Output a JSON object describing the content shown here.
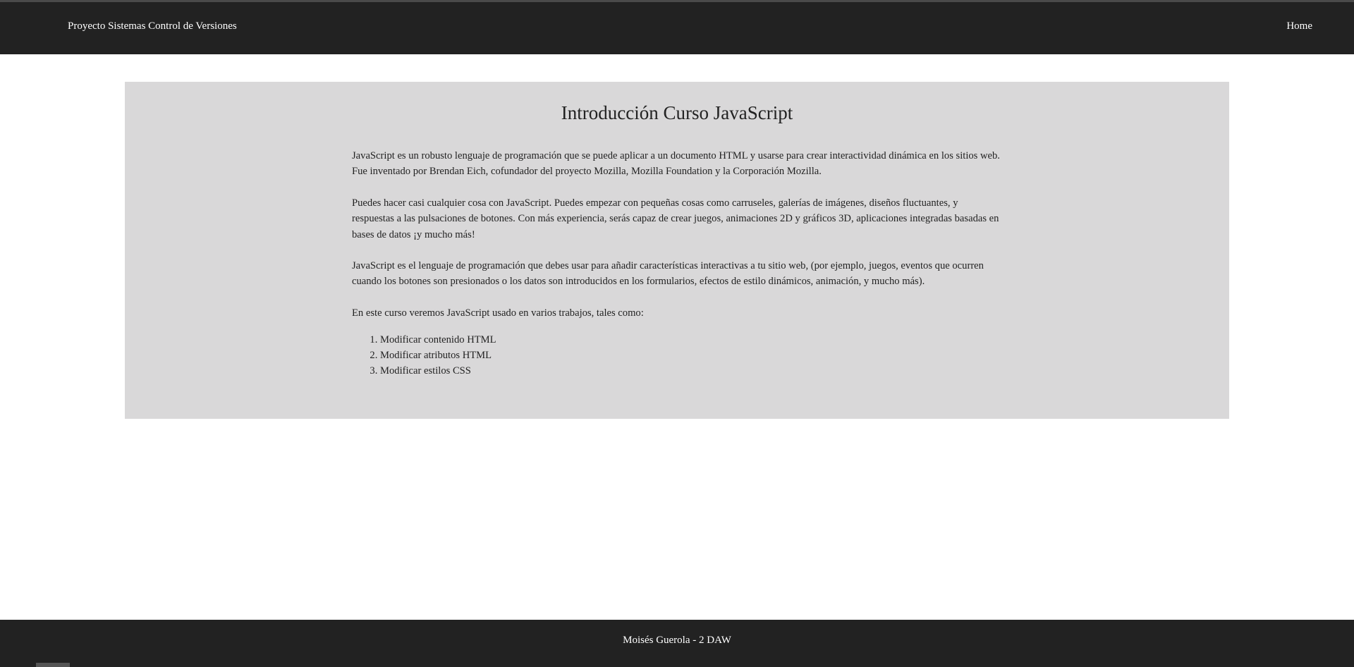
{
  "navbar": {
    "brand": "Proyecto Sistemas Control de Versiones",
    "home": "Home"
  },
  "main": {
    "title": "Introducción Curso JavaScript",
    "paragraphs": [
      "JavaScript es un robusto lenguaje de programación que se puede aplicar a un documento HTML y usarse para crear interactividad dinámica en los sitios web. Fue inventado por Brendan Eich, cofundador del proyecto Mozilla, Mozilla Foundation y la Corporación Mozilla.",
      "Puedes hacer casi cualquier cosa con JavaScript. Puedes empezar con pequeñas cosas como carruseles, galerías de imágenes, diseños fluctuantes, y respuestas a las pulsaciones de botones. Con más experiencia, serás capaz de crear juegos, animaciones 2D y gráficos 3D, aplicaciones integradas basadas en bases de datos ¡y mucho más!",
      "JavaScript es el lenguaje de programación que debes usar para añadir características interactivas a tu sitio web, (por ejemplo, juegos, eventos que ocurren cuando los botones son presionados o los datos son introducidos en los formularios, efectos de estilo dinámicos, animación, y mucho más).",
      "En este curso veremos JavaScript usado en varios trabajos, tales como:"
    ],
    "list": [
      "Modificar contenido HTML",
      "Modificar atributos HTML",
      "Modificar estilos CSS"
    ]
  },
  "footer": {
    "text": "Moisés Guerola - 2 DAW"
  },
  "colors": {
    "navbar_bg": "#222222",
    "content_bg": "#d9d8d9",
    "text": "#222222"
  }
}
